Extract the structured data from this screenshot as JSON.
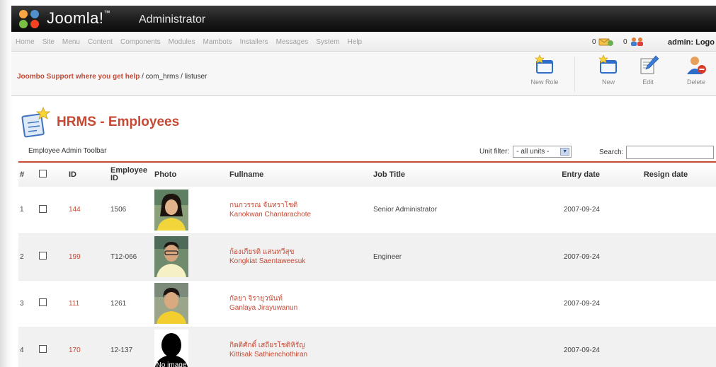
{
  "header": {
    "brand": "Joomla!",
    "subtitle": "Administrator"
  },
  "menu": {
    "items": [
      "Home",
      "Site",
      "Menu",
      "Content",
      "Components",
      "Modules",
      "Mambots",
      "Installers",
      "Messages",
      "System",
      "Help"
    ]
  },
  "status": {
    "messages_count": "0",
    "users_count": "0",
    "admin_label": "admin: Logo"
  },
  "toolbar": {
    "path_bold": "Joombo Support where you get help",
    "path_rest": " / com_hrms / listuser",
    "buttons": {
      "new_role": "New Role",
      "new": "New",
      "edit": "Edit",
      "delete": "Delete"
    }
  },
  "page": {
    "title": "HRMS - Employees",
    "sub_toolbar": "Employee Admin Toolbar",
    "filter_label": "Unit filter:",
    "filter_value": "- all units -",
    "search_label": "Search:",
    "search_value": ""
  },
  "table": {
    "headers": {
      "num": "#",
      "id": "ID",
      "employee_id": "Employee ID",
      "photo": "Photo",
      "fullname": "Fullname",
      "job_title": "Job Title",
      "entry_date": "Entry date",
      "resign_date": "Resign date"
    },
    "rows": [
      {
        "num": "1",
        "id": "144",
        "employee_id": "1506",
        "name_th": "กนกวรรณ จันทราโชติ",
        "name_en": "Kanokwan Chantarachote",
        "job_title": "Senior Administrator",
        "entry_date": "2007-09-24",
        "resign_date": ""
      },
      {
        "num": "2",
        "id": "199",
        "employee_id": "T12-066",
        "name_th": "ก้องเกียรติ แสนทวีสุข",
        "name_en": "Kongkiat Saentaweesuk",
        "job_title": "Engineer",
        "entry_date": "2007-09-24",
        "resign_date": ""
      },
      {
        "num": "3",
        "id": "111",
        "employee_id": "1261",
        "name_th": "กัลยา จิรายุวนันท์",
        "name_en": "Ganlaya Jirayuwanun",
        "job_title": "",
        "entry_date": "2007-09-24",
        "resign_date": ""
      },
      {
        "num": "4",
        "id": "170",
        "employee_id": "12-137",
        "name_th": "กิตติศักดิ์ เสถียรโชติหิรัญ",
        "name_en": "Kittisak Sathienchothiran",
        "job_title": "",
        "entry_date": "2007-09-24",
        "resign_date": "",
        "no_image_label": "No image"
      }
    ]
  },
  "colors": {
    "accent": "#c64934",
    "header_bg": "#1c1c1c"
  }
}
